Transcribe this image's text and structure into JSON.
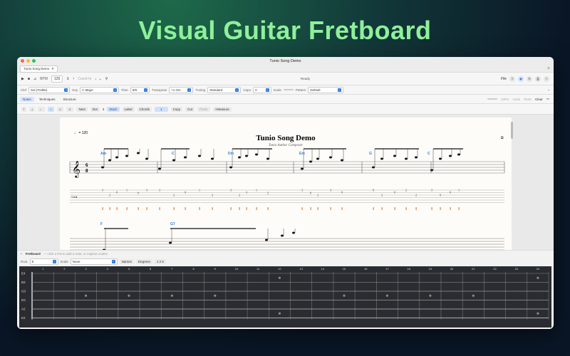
{
  "hero": {
    "title": "Visual Guitar Fretboard"
  },
  "window": {
    "title": "Tunio Song Demo"
  },
  "tabs": [
    {
      "label": "Tunio Song Demo"
    }
  ],
  "toolbar": {
    "bpm_label": "BPM",
    "bpm_value": "120",
    "count_in": "Count-In",
    "status": "Ready",
    "file_menu": "File"
  },
  "settings": {
    "clef_label": "Clef",
    "clef": "Sol (Treble)",
    "key_label": "Key",
    "key": "C Major",
    "time_label": "Time",
    "time": "6/8",
    "transpose_label": "Transpose",
    "transpose": "+1 Oct",
    "tuning_label": "Tuning",
    "tuning": "Standard",
    "capo_label": "Capo",
    "capo": "0",
    "scale_label": "Scale",
    "pattern_label": "Pattern",
    "pattern": "Default"
  },
  "segments": {
    "items": [
      "Notes",
      "Techniques",
      "Structure"
    ],
    "active": "Notes",
    "zoom": "100%",
    "undo": "Undo",
    "redo": "Redo",
    "clear": "Clear"
  },
  "notebar": {
    "next": "Next",
    "dot": "Dot",
    "dot_count": "3",
    "stack": "Stack",
    "label": "Label",
    "chords": "Chords",
    "string": "1",
    "copy": "Copy",
    "cut": "Cut",
    "paste": "Paste",
    "add_measure": "+Measure"
  },
  "score": {
    "title": "Tunio Song Demo",
    "author": "Tunio Author Composer",
    "tempo": "♩ = 120",
    "time_top": "6",
    "time_bottom": "8",
    "chords_row1": [
      "Am",
      "C",
      "Dm",
      "Em",
      "G",
      "C"
    ],
    "chords_row2": [
      "F",
      "G7"
    ]
  },
  "fretboard": {
    "title": "Fretboard",
    "hint": "— click a fret to add a note, or explore scales",
    "root_label": "Root",
    "root": "E",
    "scale_label": "Scale",
    "scale": "None",
    "names_btn": "Names",
    "degrees_btn": "Degrees",
    "intervals_btn": "1 2 5",
    "strings": [
      "E4",
      "B3",
      "G3",
      "D3",
      "A2",
      "E2"
    ],
    "frets": [
      "1",
      "2",
      "3",
      "4",
      "5",
      "6",
      "7",
      "8",
      "9",
      "10",
      "11",
      "12",
      "13",
      "14",
      "15",
      "16",
      "17",
      "18",
      "19",
      "20",
      "21",
      "22",
      "23",
      "24"
    ],
    "markers": [
      3,
      5,
      7,
      9,
      12,
      15,
      17,
      19,
      21,
      24
    ]
  },
  "colors": {
    "accent": "#2f7de1",
    "hero": "#8ff09a",
    "chord": "#2f7de1"
  }
}
